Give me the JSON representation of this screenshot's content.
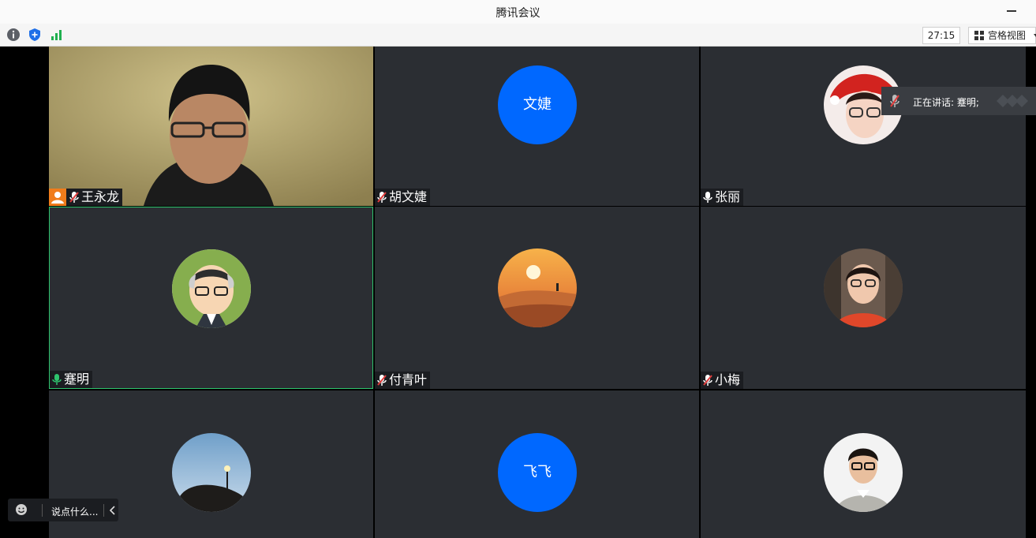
{
  "window": {
    "title": "腾讯会议"
  },
  "toolbar": {
    "timer": "27:15",
    "view_label": "宫格视图"
  },
  "participants": [
    {
      "name": "王永龙",
      "mic": "muted",
      "host": true
    },
    {
      "name": "胡文婕",
      "mic": "muted",
      "avatar_text": "文婕"
    },
    {
      "name": "张丽",
      "mic": "on"
    },
    {
      "name": "蹇明",
      "mic": "speaking",
      "active": true
    },
    {
      "name": "付青叶",
      "mic": "muted"
    },
    {
      "name": "小梅",
      "mic": "muted"
    },
    {
      "name": "",
      "mic": ""
    },
    {
      "name": "",
      "mic": "",
      "avatar_text": "飞飞"
    },
    {
      "name": "",
      "mic": ""
    }
  ],
  "speaking": {
    "label": "正在讲话: 蹇明;"
  },
  "chat": {
    "placeholder": "说点什么..."
  },
  "colors": {
    "accent": "#0068ff",
    "speaking_green": "#2ec36d",
    "host_orange": "#f07c1b",
    "muted_red": "#e03c3c"
  }
}
